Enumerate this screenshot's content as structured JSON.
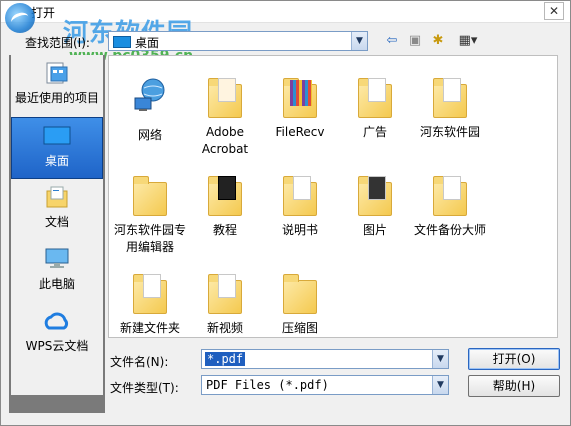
{
  "window": {
    "title": "打开",
    "close_glyph": "✕"
  },
  "watermark": {
    "name": "河东软件园",
    "url": "www.pc0359.cn"
  },
  "lookin": {
    "label": "查找范围(I):",
    "value": "桌面"
  },
  "toolbar": {
    "back": "⇦",
    "up": "▣",
    "new_folder": "✱",
    "views": "▦▾"
  },
  "places": [
    {
      "label": "最近使用的项目",
      "icon": "recent-icon"
    },
    {
      "label": "桌面",
      "icon": "desktop-icon"
    },
    {
      "label": "文档",
      "icon": "documents-icon"
    },
    {
      "label": "此电脑",
      "icon": "computer-icon"
    },
    {
      "label": "WPS云文档",
      "icon": "cloud-icon"
    }
  ],
  "files": [
    {
      "name": "网络",
      "icon": "network-icon"
    },
    {
      "name": "Adobe Acrobat",
      "icon": "folder-icon"
    },
    {
      "name": "FileRecv",
      "icon": "folder-icon"
    },
    {
      "name": "广告",
      "icon": "folder-icon"
    },
    {
      "name": "河东软件园",
      "icon": "folder-icon"
    },
    {
      "name": "河东软件园专用编辑器",
      "icon": "folder-icon"
    },
    {
      "name": "教程",
      "icon": "folder-icon"
    },
    {
      "name": "说明书",
      "icon": "folder-icon"
    },
    {
      "name": "图片",
      "icon": "folder-icon"
    },
    {
      "name": "文件备份大师",
      "icon": "folder-icon"
    },
    {
      "name": "新建文件夹",
      "icon": "folder-icon"
    },
    {
      "name": "新视频",
      "icon": "folder-icon"
    },
    {
      "name": "压缩图",
      "icon": "folder-icon"
    }
  ],
  "filename": {
    "label": "文件名(N):",
    "value": "*.pdf"
  },
  "filetype": {
    "label": "文件类型(T):",
    "value": "PDF Files (*.pdf)"
  },
  "buttons": {
    "open": "打开(O)",
    "help": "帮助(H)"
  }
}
